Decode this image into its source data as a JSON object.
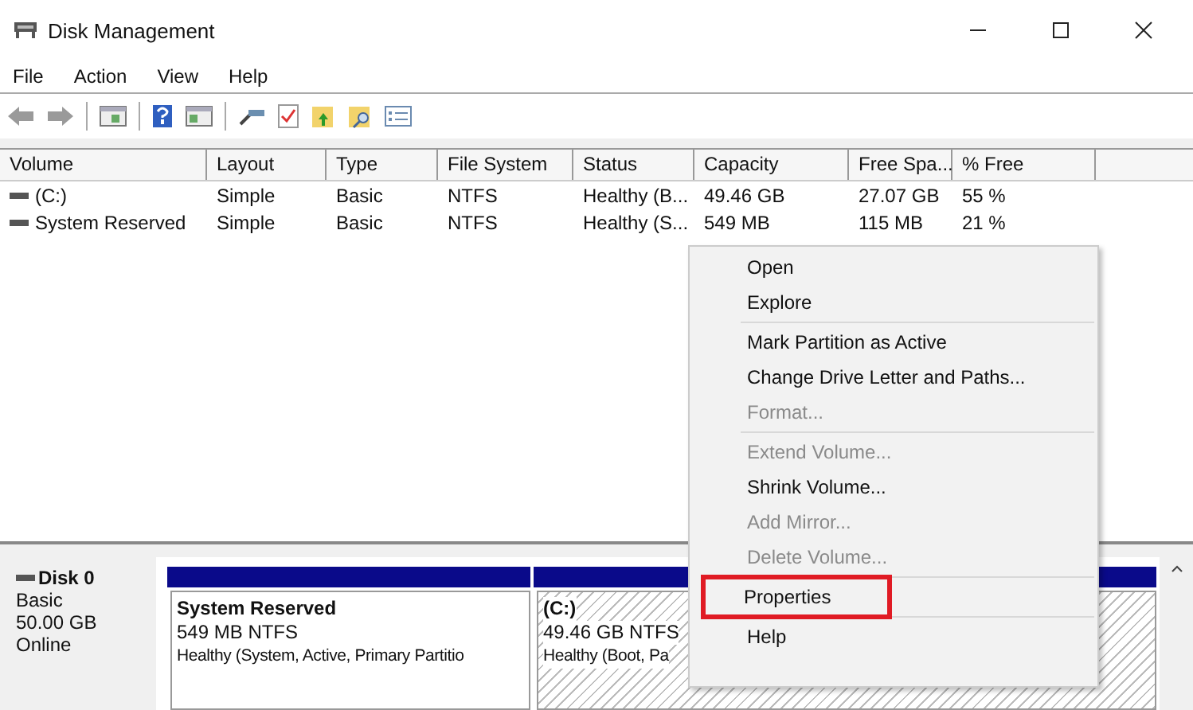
{
  "window": {
    "title": "Disk Management"
  },
  "menu_bar": [
    "File",
    "Action",
    "View",
    "Help"
  ],
  "table": {
    "columns": [
      "Volume",
      "Layout",
      "Type",
      "File System",
      "Status",
      "Capacity",
      "Free Spa...",
      "% Free"
    ],
    "rows": [
      {
        "cells": [
          "(C:)",
          "Simple",
          "Basic",
          "NTFS",
          "Healthy (B...",
          "49.46 GB",
          "27.07 GB",
          "55 %"
        ],
        "selected": false
      },
      {
        "cells": [
          "System Reserved",
          "Simple",
          "Basic",
          "NTFS",
          "Healthy (S...",
          "549 MB",
          "115 MB",
          "21 %"
        ],
        "selected": false
      }
    ]
  },
  "disk": {
    "name": "Disk 0",
    "type": "Basic",
    "size": "50.00 GB",
    "status": "Online",
    "partitions": [
      {
        "name": "System Reserved",
        "size": "549 MB NTFS",
        "status": "Healthy (System, Active, Primary Partitio",
        "selected": false
      },
      {
        "name": "(C:)",
        "size": "49.46 GB NTFS",
        "status": "Healthy (Boot, Pa",
        "selected": true
      }
    ]
  },
  "context_menu": [
    {
      "label": "Open",
      "disabled": false,
      "highlighted": false,
      "separator_after": false
    },
    {
      "label": "Explore",
      "disabled": false,
      "highlighted": false,
      "separator_after": true
    },
    {
      "label": "Mark Partition as Active",
      "disabled": false,
      "highlighted": false,
      "separator_after": false
    },
    {
      "label": "Change Drive Letter and Paths...",
      "disabled": false,
      "highlighted": false,
      "separator_after": false
    },
    {
      "label": "Format...",
      "disabled": true,
      "highlighted": false,
      "separator_after": true
    },
    {
      "label": "Extend Volume...",
      "disabled": true,
      "highlighted": false,
      "separator_after": false
    },
    {
      "label": "Shrink Volume...",
      "disabled": false,
      "highlighted": false,
      "separator_after": false
    },
    {
      "label": "Add Mirror...",
      "disabled": true,
      "highlighted": false,
      "separator_after": false
    },
    {
      "label": "Delete Volume...",
      "disabled": true,
      "highlighted": false,
      "separator_after": true
    },
    {
      "label": "Properties",
      "disabled": false,
      "highlighted": true,
      "separator_after": true
    },
    {
      "label": "Help",
      "disabled": false,
      "highlighted": false,
      "separator_after": false
    }
  ]
}
